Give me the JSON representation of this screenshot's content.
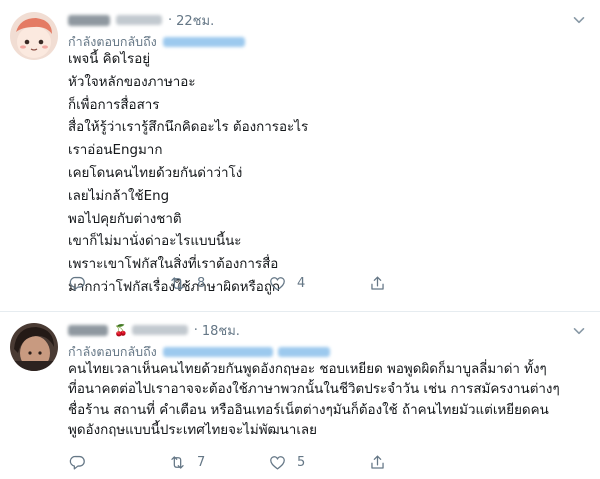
{
  "tweets": [
    {
      "time": "22ชม.",
      "reply_label": "กำลังตอบกลับถึง",
      "body": "เพจนี้ คิดไรอยู่\nหัวใจหลักของภาษาอะ\nก็เพื่อการสื่อสาร\nสื่อให้รู้ว่าเรารู้สึกนึกคิดอะไร ต้องการอะไร\nเราอ่อนEngมาก\nเคยโดนคนไทยด้วยกันด่าว่าโง่\nเลยไม่กล้าใช้Eng\nพอไปคุยกับต่างชาติ\nเขาก็ไม่มานั่งด่าอะไรแบบนี้นะ\nเพราะเขาโฟกัสในสิ่งที่เราต้องการสื่อ\nมากกว่าโฟกัสเรื่องใช้ภาษาผิดหรือถูก",
      "retweets": "8",
      "likes": "4"
    },
    {
      "time": "18ชม.",
      "reply_label": "กำลังตอบกลับถึง",
      "body": "คนไทยเวลาเห็นคนไทยด้วยกันพูดอังกฤษอะ ชอบเหยียด พอพูดผิดก็มาบูลลี่มาด่า ทั้งๆ\nที่อนาคตต่อไปเราอาจจะต้องใช้ภาษาพวกนั้นในชีวิตประจำวัน เช่น การสมัครงานต่างๆ\nชื่อร้าน สถานที่ คำเตือน หรืออินเทอร์เน็ตต่างๆมันก็ต้องใช้ ถ้าคนไทยมัวแต่เหยียดคน\nพูดอังกฤษแบบนี้ประเทศไทยจะไม่พัฒนาเลย",
      "retweets": "7",
      "likes": "5"
    }
  ],
  "icons": {
    "reply": "reply-icon",
    "retweet": "retweet-icon",
    "like": "heart-icon",
    "share": "share-icon",
    "more": "chevron-down-icon"
  },
  "colors": {
    "text": "#14171a",
    "muted": "#657786",
    "divider": "#e6ecf0"
  }
}
